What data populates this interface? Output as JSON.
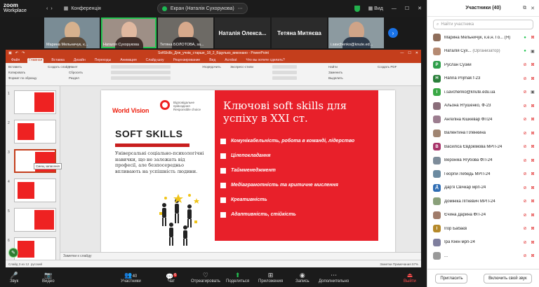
{
  "app": {
    "logo_top": "zoom",
    "logo_bottom": "Workplace",
    "conference_label": "Конференція",
    "screen_share_label": "Екран (Наталія Сухорукова)",
    "view_label": "Вид"
  },
  "thumbnails": [
    {
      "name": "Марина Мельничук, к...",
      "face": "#d6b18e",
      "body": "#5b4a3a",
      "bg": "#7a8c95"
    },
    {
      "name": "Наталія Сухорукова",
      "face": "#e0b8a0",
      "body": "#3f2e2a",
      "bg": "#9e8f86"
    },
    {
      "name": "Тетяна БОЛОТОВА, за...",
      "face": "#d7a98c",
      "body": "#2f2a2a",
      "bg": "#6d6a65"
    },
    {
      "name": "Наталія Олександрів...",
      "face": "#d3a88a",
      "body": "#5a3f3a",
      "bg": "#8a7a70"
    },
    {
      "name": "Наталія Олекса...",
      "type": "nametile"
    },
    {
      "name": "Тетяна Митяєва",
      "type": "nametile"
    },
    {
      "name": "i.savchenko@knute.ed...",
      "face": "#cfa488",
      "body": "#2e3a4a",
      "bg": "#8c9aa0"
    }
  ],
  "ppt": {
    "title": "SoftSkills_Для_учнів_старше_18_2_Бідулько_виконано - PowerPoint",
    "tabs": [
      "Файл",
      "Главная",
      "Вставка",
      "Дизайн",
      "Переходы",
      "Анимация",
      "Слайд-шоу",
      "Рецензирование",
      "Вид",
      "Acrobat",
      "Что вы хотите сделать?"
    ],
    "ribbon_labels": [
      "Вставить",
      "Копировать",
      "Формат по образцу",
      "Создать слайд",
      "Макет",
      "Сбросить",
      "Раздел",
      "Упорядочить",
      "Экспресс-стили",
      "Найти",
      "Заменить",
      "Выделить",
      "Создать PDF"
    ],
    "shrunk_label": "Шрифт",
    "tooltip": "Смещ запасенія",
    "notes_label": "Заметки к слайду",
    "status_left": "Слайд 3 из 12",
    "status_lang": "русский",
    "status_right": "Заметки   Примечания   57%",
    "slide_numbers": [
      "1",
      "2",
      "3",
      "4",
      "5",
      "6"
    ]
  },
  "slide": {
    "wv_brand": "World Vision",
    "partner": "Відповідальне\nпрiвоздiння\nResponsible choice",
    "heading": "SOFT SKILLS",
    "description": "Універсальні соціально-психологічні навички, що не залежать від професії, але безпосередньо впливають на успішність людини.",
    "title": "Ключові soft skills для успіху в ХХІ ст.",
    "items": [
      "Комунікабельність, робота в команді, лідерство",
      "Цілепокладання",
      "Таймменеджмент",
      "Медіаграмотність та критичне мислення",
      "Креативність",
      "Адаптивність, стійкість"
    ]
  },
  "panel": {
    "title": "Участники (40)",
    "search_placeholder": "Найти участника",
    "invite_label": "Пригласить",
    "unmute_label": "Включить свой звук",
    "participants": [
      {
        "name": "Марина Мельничук, к.е.н. Го... (Я)",
        "initial": "",
        "color": "#8e6d5a",
        "mic": "on",
        "cam": "off"
      },
      {
        "name": "Наталія Сух...",
        "org": "(Организатор)",
        "initial": "",
        "color": "#b58a72",
        "mic": "on",
        "cam": "on"
      },
      {
        "name": "Руслан Сузий",
        "initial": "Р",
        "color": "#2e9e49",
        "mic": "off",
        "cam": "off"
      },
      {
        "name": "Hanna Prijmak f-23",
        "initial": "H",
        "color": "#2a7f3a",
        "mic": "off",
        "cam": "off"
      },
      {
        "name": "i.savchenko@knute.edu.ua",
        "initial": "I",
        "color": "#3aa845",
        "mic": "off",
        "cam": "on"
      },
      {
        "name": "Альона Ятушенко, Ф-23",
        "initial": "",
        "color": "#8a6d7a",
        "mic": "off",
        "cam": "off"
      },
      {
        "name": "Ангеліна Кішкевар ФП24",
        "initial": "",
        "color": "#9c7d8f",
        "mic": "off",
        "cam": "off"
      },
      {
        "name": "Валентина Плёнкина",
        "initial": "",
        "color": "#a08572",
        "mic": "off",
        "cam": "off"
      },
      {
        "name": "Василіса Євдокімова МРП-24",
        "initial": "В",
        "color": "#a8346a",
        "mic": "off",
        "cam": "off"
      },
      {
        "name": "Вероніка Ягубова ФП-24",
        "initial": "",
        "color": "#7d8c9a",
        "mic": "off",
        "cam": "off"
      },
      {
        "name": "Георгій Лебедь МРП-24",
        "initial": "",
        "color": "#6b8aa0",
        "mic": "off",
        "cam": "off"
      },
      {
        "name": "Дар'я Свічкар мрп-24",
        "initial": "Д",
        "color": "#2f6db3",
        "mic": "off",
        "cam": "off"
      },
      {
        "name": "Домініка Літкевич МРП-24",
        "initial": "",
        "color": "#8aa07a",
        "mic": "off",
        "cam": "off"
      },
      {
        "name": "Єчина Дарина ФП-24",
        "initial": "",
        "color": "#a07c6a",
        "mic": "off",
        "cam": "off"
      },
      {
        "name": "Ігор Бабаєв",
        "initial": "І",
        "color": "#b5892a",
        "mic": "off",
        "cam": "off"
      },
      {
        "name": "Іра Кінін мрп-24",
        "initial": "",
        "color": "#7f7f9e",
        "mic": "off",
        "cam": "off"
      },
      {
        "name": "...",
        "initial": "",
        "color": "#999",
        "mic": "off",
        "cam": "off"
      }
    ]
  },
  "toolbar": {
    "audio": "Звук",
    "video": "Видео",
    "participants": "Участники",
    "participants_count": "40",
    "chat": "Чат",
    "chat_badge": "6",
    "react": "Отреагировать",
    "share": "Поделиться",
    "apps": "Приложения",
    "record": "Запись",
    "more": "Дополнительно",
    "exit": "Выйти"
  }
}
